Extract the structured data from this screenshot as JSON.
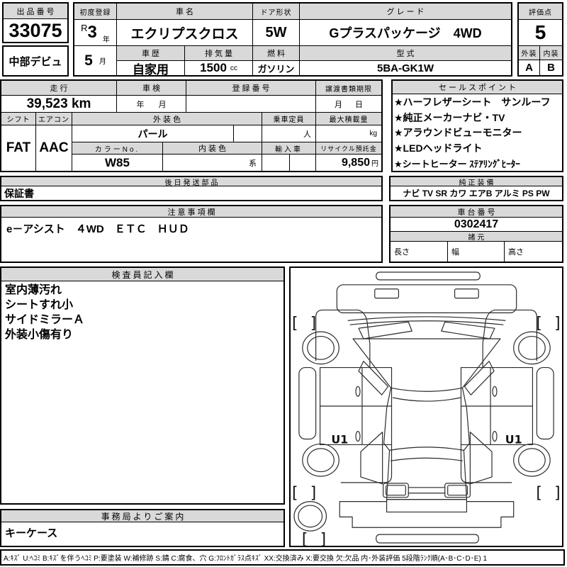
{
  "header": {
    "lot": {
      "label": "出品番号",
      "number": "33075",
      "venue": "中部デビュ"
    },
    "first_registration": {
      "label": "初度登録",
      "era": "R",
      "year": "3",
      "year_unit": "年",
      "month": "5",
      "month_unit": "月"
    },
    "car_name": {
      "label": "車名",
      "value": "エクリプスクロス"
    },
    "door_shape": {
      "label": "ドア形状",
      "value": "5W"
    },
    "grade": {
      "label": "グレード",
      "value": "Gプラスパッケージ　4WD"
    },
    "score": {
      "label": "評価点",
      "value": "5"
    },
    "history": {
      "label": "車歴",
      "value": "自家用"
    },
    "displacement": {
      "label": "排気量",
      "value": "1500",
      "unit": "cc"
    },
    "fuel": {
      "label": "燃料",
      "value": "ガソリン"
    },
    "model_code": {
      "label": "型式",
      "value": "5BA-GK1W"
    },
    "exterior": {
      "label": "外装",
      "value": "A"
    },
    "interior": {
      "label": "内装",
      "value": "B"
    }
  },
  "middle": {
    "mileage": {
      "label": "走行",
      "value": "39,523 km"
    },
    "inspection": {
      "label": "車検",
      "year_unit": "年",
      "month_unit": "月"
    },
    "registration_no": {
      "label": "登録番号"
    },
    "transfer_deadline": {
      "label": "譲渡書類期限",
      "month_unit": "月",
      "day_unit": "日"
    },
    "shift": {
      "label": "シフト",
      "value": "FAT"
    },
    "aircon": {
      "label": "エアコン",
      "value": "AAC"
    },
    "exterior_color": {
      "label": "外装色",
      "value": "パール"
    },
    "color_no": {
      "label": "カラーNo.",
      "value": "W85"
    },
    "interior_color": {
      "label": "内装色",
      "suffix": "系"
    },
    "capacity": {
      "label": "乗車定員",
      "unit": "人"
    },
    "import_car": {
      "label": "輸入車"
    },
    "max_load": {
      "label": "最大積載量",
      "unit": "kg"
    },
    "recycle_deposit": {
      "label": "リサイクル預託金",
      "value": "9,850",
      "unit": "円"
    }
  },
  "sales_points": {
    "label": "セールスポイント",
    "items": [
      "★ハーフレザーシート　サンルーフ",
      "★純正メーカーナビ・TV",
      "★アラウンドビューモニター",
      "★LEDヘッドライト",
      "★シートヒーター ｽﾃｱﾘﾝｸﾞﾋｰﾀｰ"
    ]
  },
  "later_shipping": {
    "label": "後日発送部品",
    "value": "保証書"
  },
  "genuine_equipment": {
    "label": "純正装備",
    "value": "ナビ TV SR カワ エアB アルミ PS PW"
  },
  "cautions": {
    "label": "注意事項欄",
    "value": "e－アシスト　４WD　ＥＴＣ　ＨＵＤ"
  },
  "chassis_no": {
    "label": "車台番号",
    "value": "0302417"
  },
  "specs": {
    "label": "諸元",
    "length_label": "長さ",
    "width_label": "幅",
    "height_label": "高さ"
  },
  "inspector_notes": {
    "label": "検査員記入欄",
    "lines": [
      "室内薄汚れ",
      "シートすれ小",
      "サイドミラーＡ",
      "外装小傷有り"
    ]
  },
  "office_info": {
    "label": "事務局よりご案内",
    "value": "キーケース"
  },
  "diagram": {
    "marks": [
      "U1",
      "U1"
    ],
    "bracket_open": "[",
    "bracket_close": "]"
  },
  "legend": "A:ｷｽﾞ U:ﾍｺﾐ B:ｷｽﾞを伴うﾍｺﾐ P:要塗装 W:補修跡 S:錆 C:腐食、穴 G:ﾌﾛﾝﾄｶﾞﾗｽ点ｷｽﾞ XX:交換済み X:要交換 欠:欠品 内･外装評価 5段階ﾗﾝｸ順(A･B･C･D･E) 1"
}
